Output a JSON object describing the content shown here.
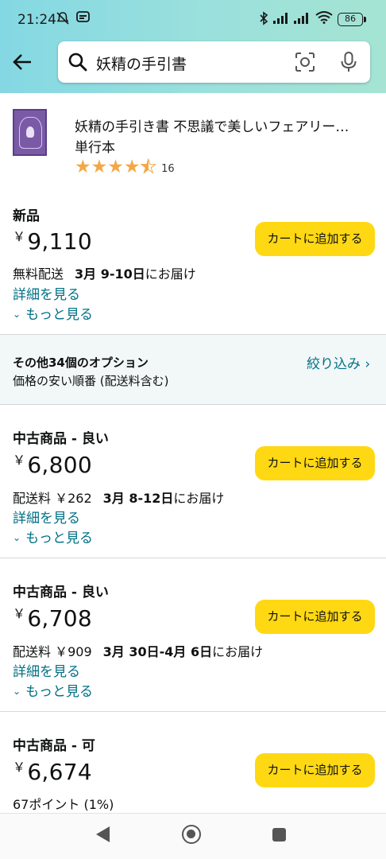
{
  "status_bar": {
    "time": "21:24",
    "battery": "86"
  },
  "search": {
    "query": "妖精の手引書"
  },
  "product": {
    "title": "妖精の手引き書 不思議で美しいフェアリー…",
    "format": "単行本",
    "rating": 4.5,
    "rating_count": "16",
    "star_color": "#f3a847"
  },
  "offers": [
    {
      "condition": "新品",
      "yen": "￥",
      "price": "9,110",
      "cart_label": "カートに追加する",
      "shipping_prefix": "無料配送",
      "delivery": "3月 9-10日",
      "delivery_suffix": "にお届け",
      "details_label": "詳細を見る",
      "more_label": "もっと見る"
    },
    {
      "condition": "中古商品 - 良い",
      "yen": "￥",
      "price": "6,800",
      "cart_label": "カートに追加する",
      "shipping_prefix": "配送料 ￥262",
      "delivery": "3月 8-12日",
      "delivery_suffix": "にお届け",
      "details_label": "詳細を見る",
      "more_label": "もっと見る"
    },
    {
      "condition": "中古商品 - 良い",
      "yen": "￥",
      "price": "6,708",
      "cart_label": "カートに追加する",
      "shipping_prefix": "配送料 ￥909",
      "delivery": "3月 30日-4月 6日",
      "delivery_suffix": "にお届け",
      "details_label": "詳細を見る",
      "more_label": "もっと見る"
    },
    {
      "condition": "中古商品 - 可",
      "yen": "￥",
      "price": "6,674",
      "cart_label": "カートに追加する",
      "points": "67ポイント (1%)"
    }
  ],
  "options": {
    "title": "その他34個のオプション",
    "subtitle": "価格の安い順番 (配送料含む)",
    "filter_label": "絞り込み ›"
  },
  "colors": {
    "accent_link": "#007185",
    "cart_button": "#ffd814"
  }
}
